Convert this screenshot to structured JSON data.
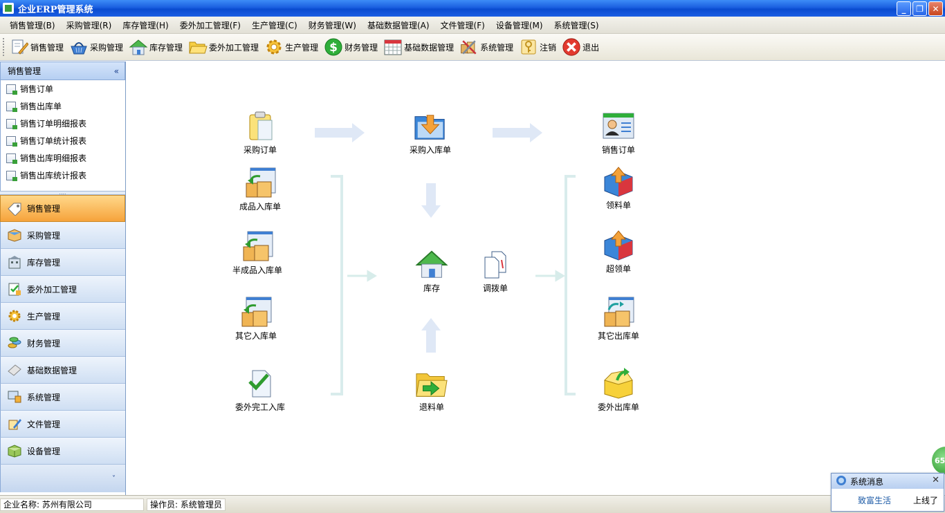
{
  "window": {
    "title": "企业ERP管理系统"
  },
  "menubar": [
    "销售管理(B)",
    "采购管理(R)",
    "库存管理(H)",
    "委外加工管理(F)",
    "生产管理(C)",
    "财务管理(W)",
    "基础数据管理(A)",
    "文件管理(F)",
    "设备管理(M)",
    "系统管理(S)"
  ],
  "toolbar": [
    {
      "label": "销售管理",
      "icon": "pencil-doc-icon"
    },
    {
      "label": "采购管理",
      "icon": "basket-icon"
    },
    {
      "label": "库存管理",
      "icon": "house-icon"
    },
    {
      "label": "委外加工管理",
      "icon": "folder-icon"
    },
    {
      "label": "生产管理",
      "icon": "gear-icon"
    },
    {
      "label": "财务管理",
      "icon": "dollar-icon"
    },
    {
      "label": "基础数据管理",
      "icon": "calendar-icon"
    },
    {
      "label": "系统管理",
      "icon": "tools-icon"
    },
    {
      "label": "注销",
      "icon": "key-icon"
    },
    {
      "label": "退出",
      "icon": "exit-icon"
    }
  ],
  "leftpanel": {
    "title": "销售管理",
    "items": [
      "销售订单",
      "销售出库单",
      "销售订单明细报表",
      "销售订单统计报表",
      "销售出库明细报表",
      "销售出库统计报表"
    ],
    "groups": [
      "销售管理",
      "采购管理",
      "库存管理",
      "委外加工管理",
      "生产管理",
      "财务管理",
      "基础数据管理",
      "系统管理",
      "文件管理",
      "设备管理"
    ]
  },
  "flow": {
    "purchase_order": "采购订单",
    "purchase_inbound": "采购入库单",
    "sales_order": "销售订单",
    "finished_inbound": "成品入库单",
    "semi_inbound": "半成品入库单",
    "other_inbound": "其它入库单",
    "outsource_done_inbound": "委外完工入库",
    "inventory": "库存",
    "transfer": "调拨单",
    "material_return": "退料单",
    "material_requisition": "领料单",
    "over_requisition": "超领单",
    "other_outbound": "其它出库单",
    "outsource_outbound": "委外出库单"
  },
  "statusbar": {
    "company": "企业名称: 苏州有限公司",
    "operator": "操作员: 系统管理员"
  },
  "message": {
    "title": "系统消息",
    "link": "致富生活",
    "status": "上线了"
  },
  "badge": "65",
  "colors": {
    "titlebar": "#1a5fe0",
    "active_group": "#f6a33b",
    "arrow": "#dbe6f5"
  }
}
